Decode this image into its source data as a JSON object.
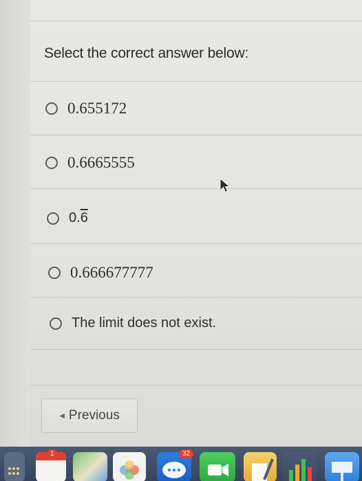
{
  "question": {
    "prompt": "Select the correct answer below:"
  },
  "options": [
    {
      "label": "0.655172",
      "style": "serif"
    },
    {
      "label": "0.6665555",
      "style": "serif"
    },
    {
      "prefix": "0.",
      "repeating_digit": "6",
      "style": "sans"
    },
    {
      "label": "0.666677777",
      "style": "serif"
    },
    {
      "label": "The limit does not exist.",
      "style": "sans"
    }
  ],
  "navigation": {
    "previous_label": "Previous"
  },
  "dock": {
    "badges": {
      "calendar": "1",
      "messages": "32"
    },
    "icons": [
      "launchpad-icon",
      "calendar-icon",
      "maps-icon",
      "photos-icon",
      "messages-icon",
      "facetime-icon",
      "pages-icon",
      "numbers-icon",
      "keynote-icon"
    ]
  },
  "colors": {
    "panel_bg": "#e3e4df",
    "text": "#2b2b2b",
    "radio_border": "#5c5d58",
    "dock_bg": "#3e4b63",
    "badge": "#e0412f"
  }
}
